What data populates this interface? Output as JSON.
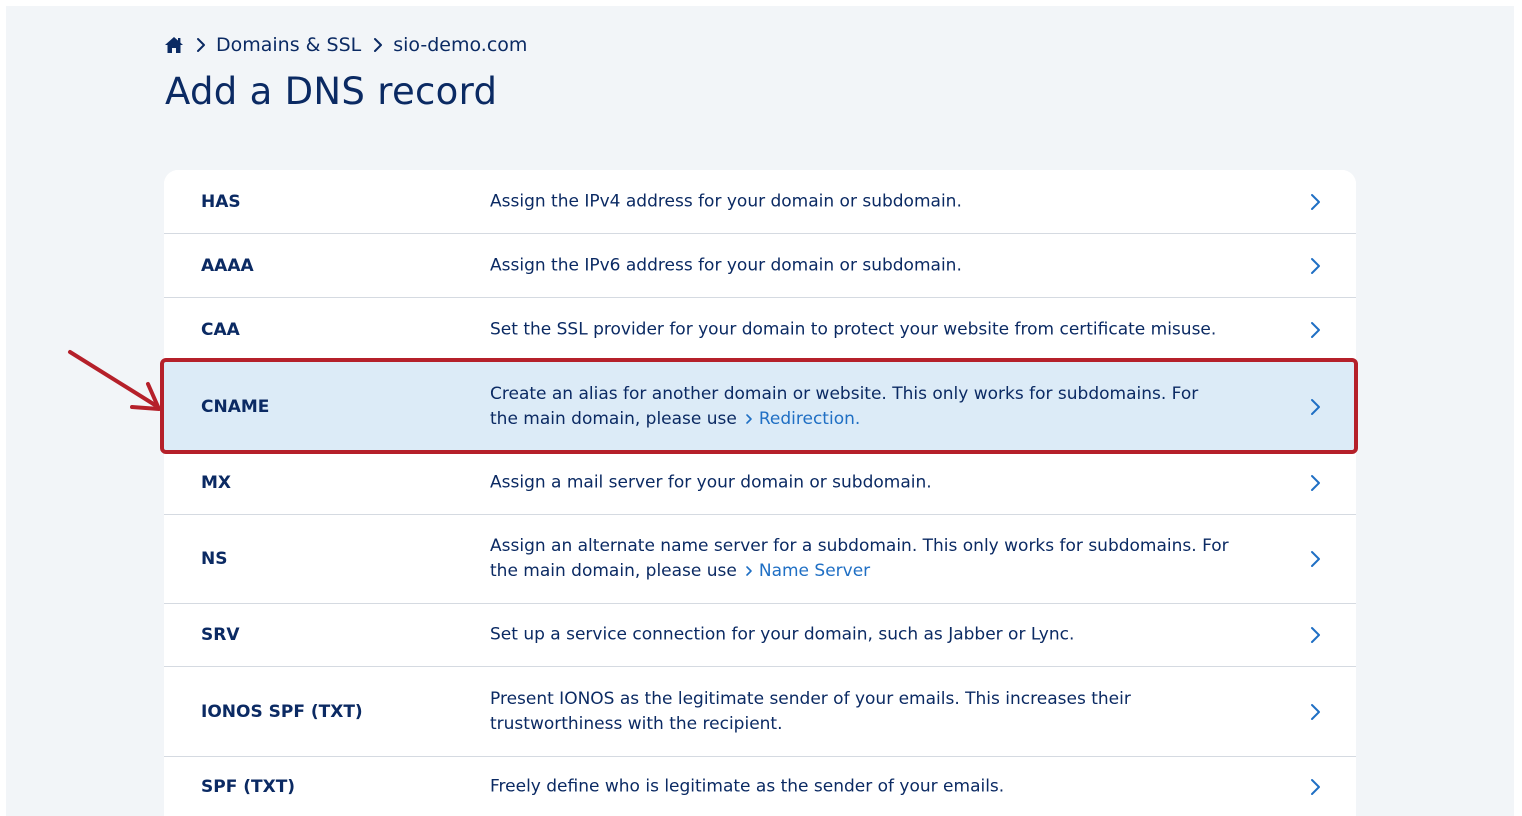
{
  "breadcrumb": {
    "home_icon": "home-icon",
    "items": [
      "Domains & SSL",
      "sio-demo.com"
    ]
  },
  "page": {
    "title": "Add a DNS record"
  },
  "records": [
    {
      "type": "HAS",
      "description": "Assign the IPv4 address for your domain or subdomain."
    },
    {
      "type": "AAAA",
      "description": "Assign the IPv6 address for your domain or subdomain."
    },
    {
      "type": "CAA",
      "description": "Set the SSL provider for your domain to protect your website from certificate misuse."
    },
    {
      "type": "CNAME",
      "description": "Create an alias for another domain or website. This only works for subdomains. For the main domain, please use",
      "link": "Redirection."
    },
    {
      "type": "MX",
      "description": "Assign a mail server for your domain or subdomain."
    },
    {
      "type": "NS",
      "description": "Assign an alternate name server for a subdomain. This only works for subdomains. For the main domain, please use",
      "link": "Name Server"
    },
    {
      "type": "SRV",
      "description": "Set up a service connection for your domain, such as Jabber or Lync."
    },
    {
      "type": "IONOS SPF (TXT)",
      "description": "Present IONOS as the legitimate sender of your emails. This increases their trustworthiness with the recipient."
    },
    {
      "type": "SPF (TXT)",
      "description": "Freely define who is legitimate as the sender of your emails."
    }
  ],
  "highlighted_record": "CNAME",
  "colors": {
    "text_primary": "#0b2a63",
    "link": "#1f6fc4",
    "highlight_row": "#dcebf7",
    "annotation_red": "#b5202a",
    "page_bg": "#f2f5f8"
  }
}
